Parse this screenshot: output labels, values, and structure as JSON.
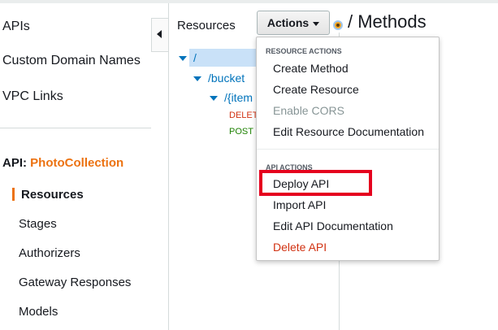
{
  "nav": {
    "links": [
      "APIs",
      "Custom Domain Names",
      "VPC Links"
    ],
    "api_prefix": "API:",
    "api_name": "PhotoCollection",
    "subnav": [
      "Resources",
      "Stages",
      "Authorizers",
      "Gateway Responses",
      "Models"
    ]
  },
  "resources": {
    "title": "Resources",
    "tree": [
      "/",
      "/bucket",
      "/{item"
    ],
    "methods": [
      "DELET",
      "POST"
    ]
  },
  "actions_button": {
    "label": "Actions"
  },
  "methods_title": "/ Methods",
  "dropdown": {
    "resource_section": "Resource Actions",
    "resource_items": [
      "Create Method",
      "Create Resource",
      "Enable CORS",
      "Edit Resource Documentation"
    ],
    "api_section": "API Actions",
    "api_items": [
      "Deploy API",
      "Import API",
      "Edit API Documentation",
      "Delete API"
    ]
  },
  "colors": {
    "accent": "#ec7211",
    "link": "#0073bb",
    "danger": "#d13212",
    "highlight": "#e5001e"
  }
}
